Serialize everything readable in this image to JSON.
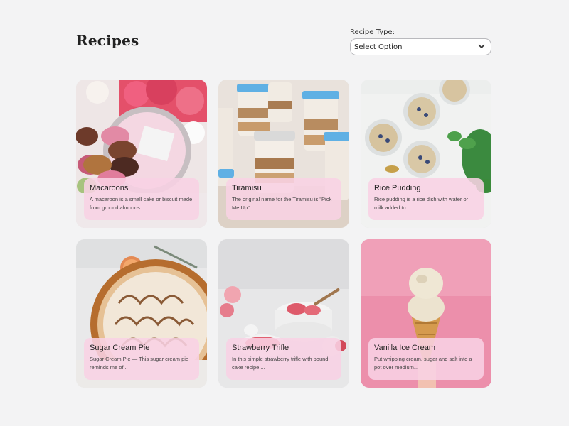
{
  "page": {
    "title": "Recipes"
  },
  "filter": {
    "label": "Recipe Type:",
    "selected": "Select Option",
    "icon": "chevron-down-icon"
  },
  "colors": {
    "background": "#f3f3f4",
    "overlay": "#f8d2e4",
    "text": "#222222"
  },
  "recipes": [
    {
      "title": "Macaroons",
      "description": "A macaroon is a small cake or biscuit made from ground almonds...",
      "image": "macaroons-photo"
    },
    {
      "title": "Tiramisu",
      "description": "The original name for the Tiramisu is \"Pick Me Up\"...",
      "image": "tiramisu-jars-photo"
    },
    {
      "title": "Rice Pudding",
      "description": "Rice pudding is a rice dish with water or milk added to...",
      "image": "rice-pudding-bowls-photo"
    },
    {
      "title": "Sugar Cream Pie",
      "description": "Sugar Cream Pie — This sugar cream pie reminds me of...",
      "image": "sugar-cream-pie-photo"
    },
    {
      "title": "Strawberry Trifle",
      "description": "In this simple strawberry trifle with pound cake recipe,...",
      "image": "strawberry-trifle-photo"
    },
    {
      "title": "Vanilla Ice Cream",
      "description": "Put whipping cream, sugar and salt into a pot over medium...",
      "image": "vanilla-ice-cream-cone-photo"
    }
  ]
}
